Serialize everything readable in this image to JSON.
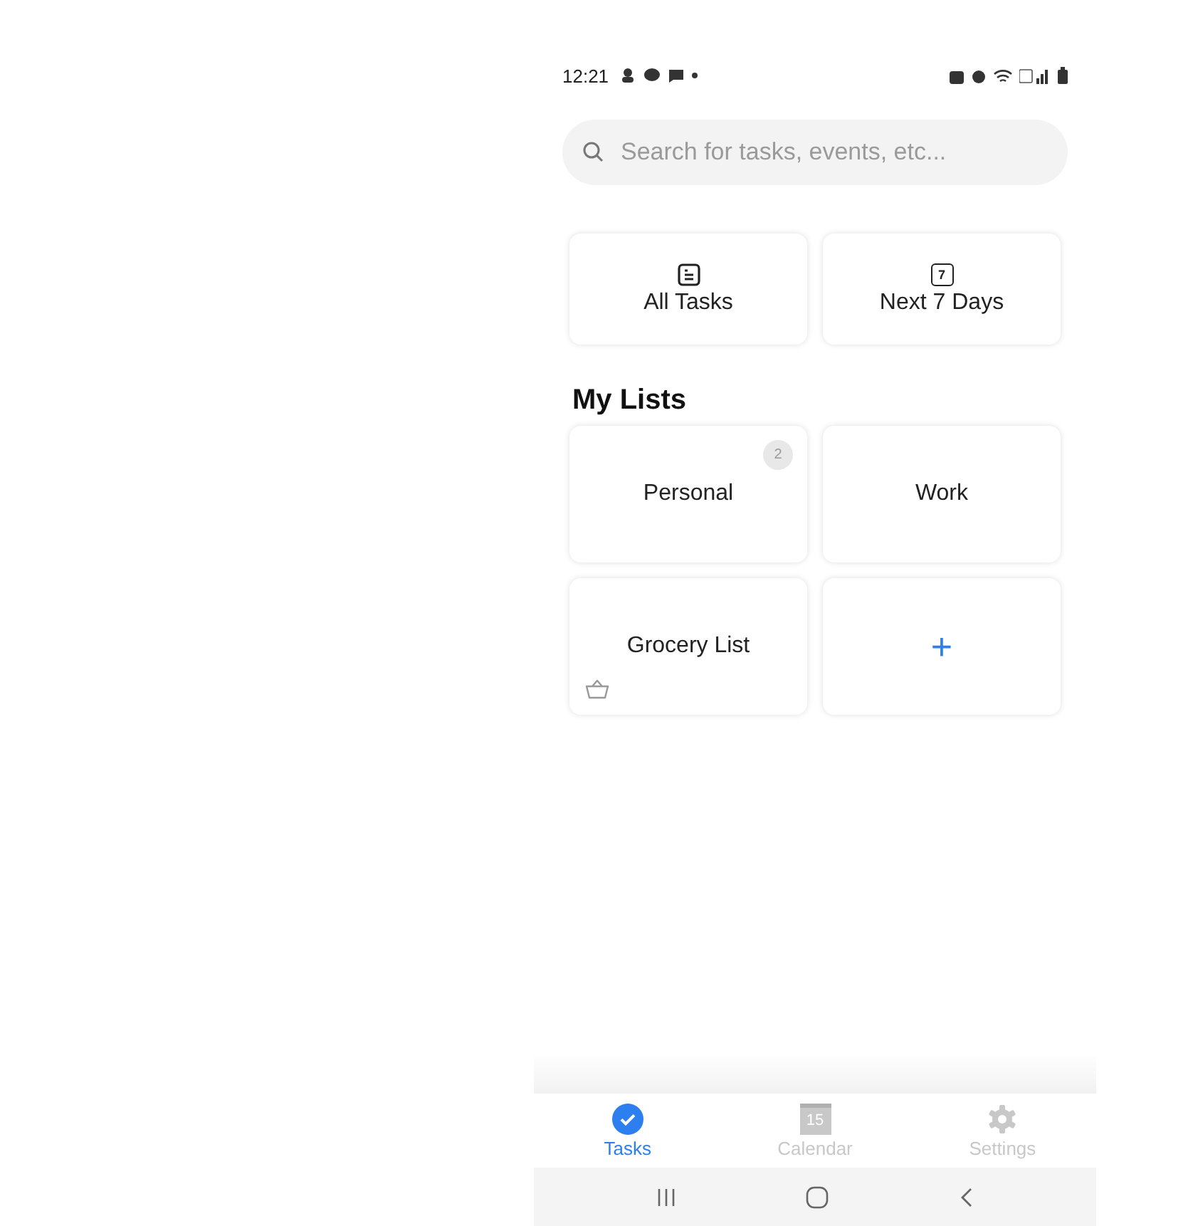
{
  "status_bar": {
    "time": "12:21"
  },
  "search": {
    "placeholder": "Search for tasks, events, etc..."
  },
  "quick_filters": [
    {
      "label": "All Tasks",
      "kind": "list"
    },
    {
      "label": "Next 7 Days",
      "kind": "week",
      "icon_text": "7"
    }
  ],
  "my_lists": {
    "title": "My Lists",
    "items": [
      {
        "label": "Personal",
        "kind": "list",
        "badge": "2"
      },
      {
        "label": "Work",
        "kind": "list"
      },
      {
        "label": "Grocery List",
        "kind": "grocery"
      },
      {
        "label": "+",
        "kind": "add"
      }
    ]
  },
  "bottom_nav": [
    {
      "label": "Tasks",
      "kind": "tasks",
      "selected": true
    },
    {
      "label": "Calendar",
      "kind": "calendar",
      "icon_text": "15",
      "selected": false
    },
    {
      "label": "Settings",
      "kind": "settings",
      "selected": false
    }
  ]
}
